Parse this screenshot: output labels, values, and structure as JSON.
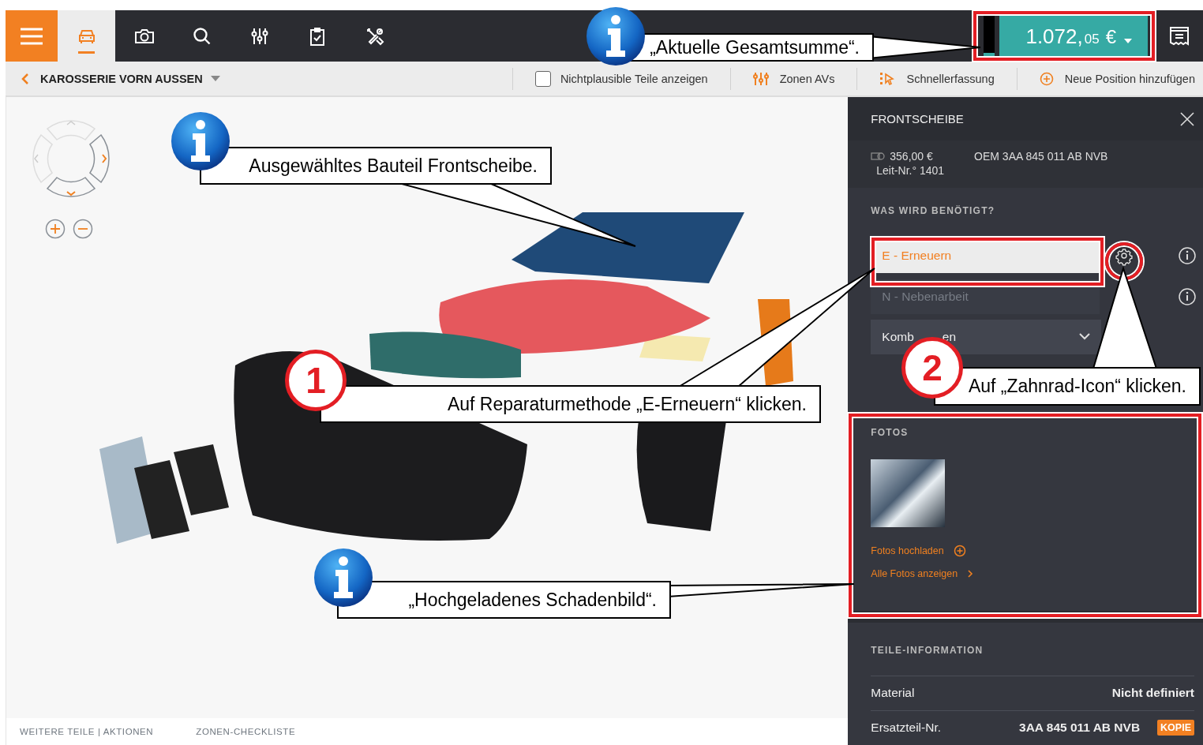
{
  "top_bar": {
    "tabs": [
      {
        "kind": "car",
        "selected": true
      },
      {
        "kind": "camera",
        "selected": false
      },
      {
        "kind": "search",
        "selected": false
      },
      {
        "kind": "sliders",
        "selected": false
      },
      {
        "kind": "clipboard",
        "selected": false
      },
      {
        "kind": "tools",
        "selected": false
      }
    ],
    "total": {
      "main": "1.072,",
      "cents": "05",
      "currency": "€"
    }
  },
  "toolbar": {
    "title": "KAROSSERIE VORN AUSSEN",
    "checkbox": {
      "label": "Nichtplausible Teile anzeigen",
      "checked": false
    },
    "actions": [
      {
        "kind": "zones",
        "label": "Zonen AVs"
      },
      {
        "kind": "quick",
        "label": "Schnellerfassung"
      },
      {
        "kind": "add",
        "label": "Neue Position hinzufügen"
      }
    ]
  },
  "bottom_tabs": [
    "WEITERE TEILE | AKTIONEN",
    "ZONEN-CHECKLISTE"
  ],
  "panel": {
    "title": "FRONTSCHEIBE",
    "price": "356,00 €",
    "leit_nr": "Leit-Nr.° 1401",
    "oem": "OEM 3AA 845 011 AB NVB",
    "needed_title": "WAS WIRD BENÖTIGT?",
    "options": [
      {
        "label": "E - Erneuern",
        "selected": true
      },
      {
        "label": "N - Nebenarbeit",
        "selected": false
      }
    ],
    "combo": {
      "label_start": "Komb",
      "label_end": "en"
    },
    "photos_title": "FOTOS",
    "upload_link": "Fotos hochladen",
    "all_link": "Alle Fotos anzeigen",
    "info_title": "TEILE-INFORMATION",
    "info_rows": [
      {
        "label": "Material",
        "value": "Nicht definiert"
      },
      {
        "label": "Ersatzteil-Nr.",
        "value": "3AA 845 011 AB NVB",
        "badge": "KOPIE"
      }
    ]
  },
  "annotations": [
    {
      "kind": "info",
      "text": "„Aktuelle Gesamtsumme“."
    },
    {
      "kind": "info",
      "text": "Ausgewähltes Bauteil Frontscheibe."
    },
    {
      "kind": "step",
      "number": "1",
      "text": "Auf Reparaturmethode „E-Erneuern“ klicken."
    },
    {
      "kind": "step",
      "number": "2",
      "text": "Auf „Zahnrad-Icon“ klicken."
    },
    {
      "kind": "info",
      "text": "„Hochgeladenes Schadenbild“."
    }
  ]
}
